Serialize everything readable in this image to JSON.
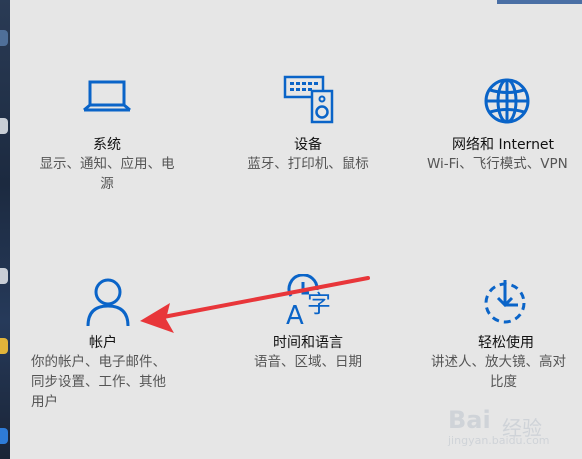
{
  "tiles": [
    {
      "title": "系统",
      "desc_lines": [
        "显示、通知、应用、电",
        "源"
      ],
      "icon": "laptop-icon"
    },
    {
      "title": "设备",
      "desc_lines": [
        "蓝牙、打印机、鼠标"
      ],
      "icon": "keyboard-speaker-icon"
    },
    {
      "title": "网络和 Internet",
      "desc_lines": [
        "Wi-Fi、飞行模式、VPN"
      ],
      "icon": "globe-icon"
    },
    {
      "title": "帐户",
      "desc_lines": [
        "你的帐户、电子邮件、",
        "同步设置、工作、其他",
        "用户"
      ],
      "icon": "person-icon"
    },
    {
      "title": "时间和语言",
      "desc_lines": [
        "语音、区域、日期"
      ],
      "icon": "time-language-icon"
    },
    {
      "title": "轻松使用",
      "desc_lines": [
        "讲述人、放大镜、高对",
        "比度"
      ],
      "icon": "ease-of-access-icon"
    }
  ],
  "watermark": {
    "brand": "Bai",
    "suffix": "经验",
    "url": "jingyan.baidu.com"
  },
  "colors": {
    "accent": "#0a64c8",
    "arrow": "#e8363a",
    "background": "#e6e6e6"
  }
}
